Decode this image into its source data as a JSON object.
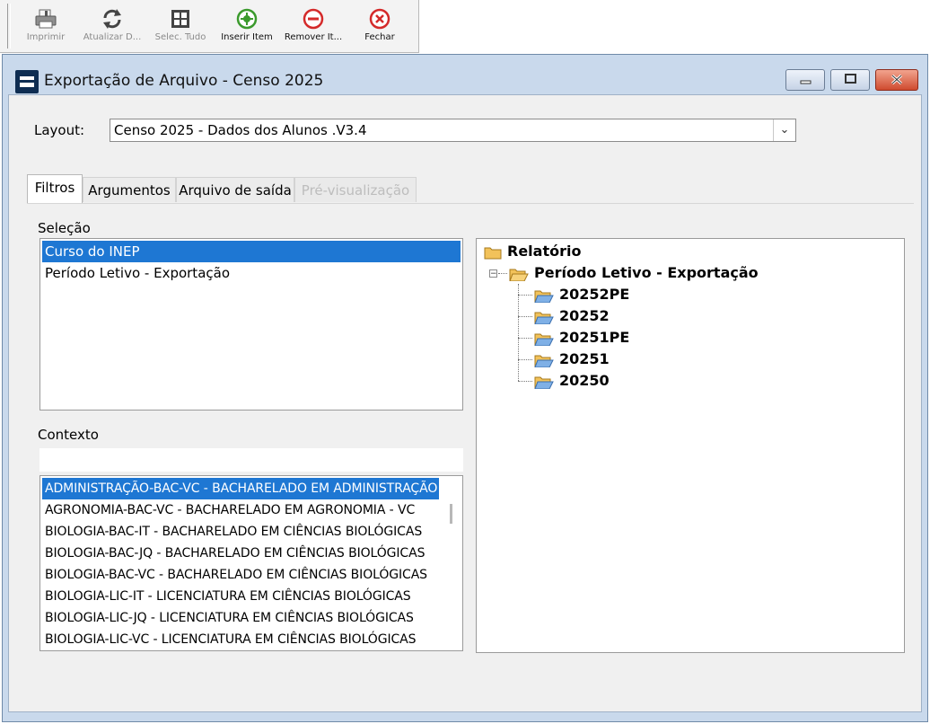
{
  "toolbar": {
    "buttons": [
      {
        "label": "Imprimir",
        "icon": "printer-icon",
        "enabled": false
      },
      {
        "label": "Atualizar D...",
        "icon": "refresh-icon",
        "enabled": false
      },
      {
        "label": "Selec. Tudo",
        "icon": "grid-select-all-icon",
        "enabled": false
      },
      {
        "label": "Inserir Item",
        "icon": "add-circle-icon",
        "enabled": true
      },
      {
        "label": "Remover It...",
        "icon": "remove-circle-icon",
        "enabled": true
      },
      {
        "label": "Fechar",
        "icon": "close-circle-icon",
        "enabled": true
      }
    ]
  },
  "window": {
    "title": "Exportação de Arquivo - Censo 2025"
  },
  "layout": {
    "label": "Layout:",
    "value": "Censo 2025 - Dados dos Alunos .V3.4"
  },
  "tabs": [
    {
      "label": "Filtros",
      "state": "active"
    },
    {
      "label": "Argumentos",
      "state": "normal"
    },
    {
      "label": "Arquivo de saída",
      "state": "normal"
    },
    {
      "label": "Pré-visualização",
      "state": "disabled"
    }
  ],
  "selecao": {
    "label": "Seleção",
    "items": [
      "Curso do INEP",
      "Período Letivo - Exportação"
    ],
    "selected_index": 0
  },
  "contexto": {
    "label": "Contexto",
    "search_value": "",
    "items": [
      "ADMINISTRAÇÃO-BAC-VC - BACHARELADO EM ADMINISTRAÇÃO",
      "AGRONOMIA-BAC-VC - BACHARELADO EM AGRONOMIA - VC",
      "BIOLOGIA-BAC-IT - BACHARELADO EM CIÊNCIAS BIOLÓGICAS",
      "BIOLOGIA-BAC-JQ - BACHARELADO EM CIÊNCIAS BIOLÓGICAS",
      "BIOLOGIA-BAC-VC - BACHARELADO EM CIÊNCIAS BIOLÓGICAS",
      "BIOLOGIA-LIC-IT - LICENCIATURA EM CIÊNCIAS BIOLÓGICAS",
      "BIOLOGIA-LIC-JQ - LICENCIATURA EM CIÊNCIAS BIOLÓGICAS",
      "BIOLOGIA-LIC-VC - LICENCIATURA EM CIÊNCIAS BIOLÓGICAS"
    ],
    "selected_index": 0
  },
  "tree": {
    "root": "Relatório",
    "group": "Período Letivo - Exportação",
    "leaves": [
      "20252PE",
      "20252",
      "20251PE",
      "20251",
      "20250"
    ]
  },
  "colors": {
    "selection": "#1e77d3",
    "window_frame": "#c9d9ec",
    "folder": "#f2c25a"
  }
}
